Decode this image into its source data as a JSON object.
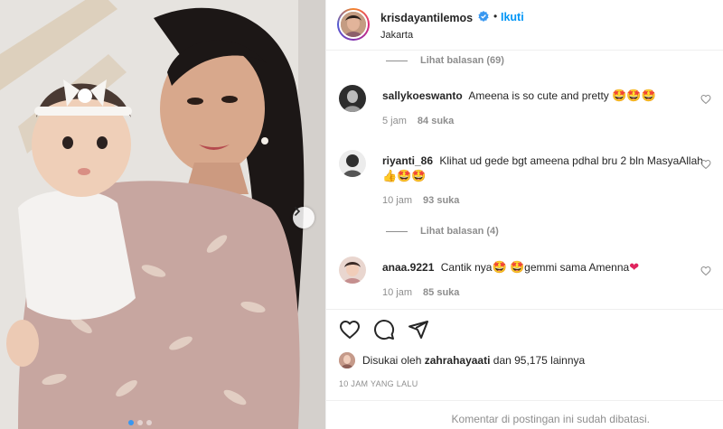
{
  "post_header": {
    "username": "krisdayantilemos",
    "separator": "•",
    "follow_label": "Ikuti",
    "location": "Jakarta"
  },
  "comments": {
    "view_replies_1": "Lihat balasan (69)",
    "view_replies_2": "Lihat balasan (4)",
    "items": [
      {
        "username": "sallykoeswanto",
        "text": "Ameena is so cute and pretty",
        "emojis": "🤩🤩🤩",
        "time": "5 jam",
        "likes": "84 suka"
      },
      {
        "username": "riyanti_86",
        "text": "Klihat ud gede bgt ameena pdhal bru 2 bln MasyaAllah",
        "emojis": "👍🤩🤩",
        "time": "10 jam",
        "likes": "93 suka"
      },
      {
        "username": "anaa.9221",
        "text_part1": "Cantik nya",
        "emoji1": "🤩",
        "emoji2": "🤩",
        "text_part2": "gemmi sama Amenna",
        "emoji3": "❤",
        "time": "10 jam",
        "likes": "85 suka"
      }
    ]
  },
  "actions": {
    "like_icon": "heart-outline-icon",
    "comment_icon": "comment-bubble-icon",
    "share_icon": "paper-plane-icon"
  },
  "likes_summary": {
    "prefix": "Disukai oleh",
    "user": "zahrahayaati",
    "suffix": "dan 95,175 lainnya"
  },
  "timestamp": "10 JAM YANG LALU",
  "comments_disabled": "Komentar di postingan ini sudah dibatasi.",
  "colors": {
    "accent_blue": "#0095f6",
    "verified_blue": "#3897f0",
    "text_primary": "#262626",
    "text_secondary": "#8e8e8e",
    "like_red": "#ed4956"
  }
}
